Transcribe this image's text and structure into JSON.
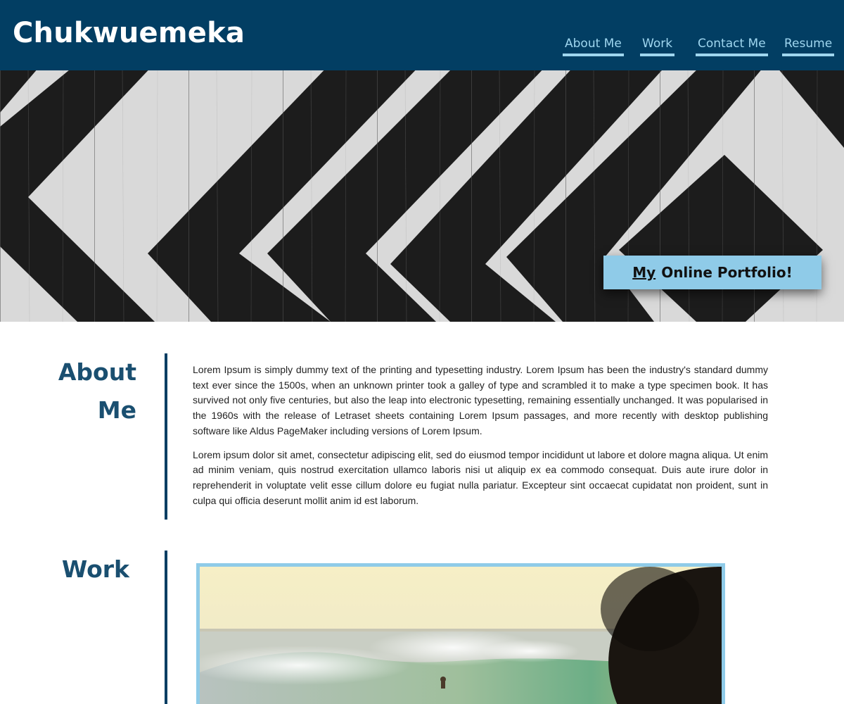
{
  "header": {
    "site_name": "Chukwuemeka",
    "nav": [
      {
        "label": "About Me"
      },
      {
        "label": "Work"
      },
      {
        "label": "Contact Me"
      },
      {
        "label": "Resume"
      }
    ]
  },
  "hero": {
    "badge_prefix": "My",
    "badge_rest": "Online Portfolio!"
  },
  "about": {
    "title_line1": "About",
    "title_line2": "Me",
    "paragraphs": [
      "Lorem Ipsum is simply dummy text of the printing and typesetting industry. Lorem Ipsum has been the industry's standard dummy text ever since the 1500s, when an unknown printer took a galley of type and scrambled it to make a type specimen book. It has survived not only five centuries, but also the leap into electronic typesetting, remaining essentially unchanged. It was popularised in the 1960s with the release of Letraset sheets containing Lorem Ipsum passages, and more recently with desktop publishing software like Aldus PageMaker including versions of Lorem Ipsum.",
      "Lorem ipsum dolor sit amet, consectetur adipiscing elit, sed do eiusmod tempor incididunt ut labore et dolore magna aliqua. Ut enim ad minim veniam, quis nostrud exercitation ullamco laboris nisi ut aliquip ex ea commodo consequat. Duis aute irure dolor in reprehenderit in voluptate velit esse cillum dolore eu fugiat nulla pariatur. Excepteur sint occaecat cupidatat non proident, sunt in culpa qui officia deserunt mollit anim id est laborum."
    ]
  },
  "work": {
    "title": "Work",
    "image": "surfer-wave-photo"
  },
  "colors": {
    "header_bg": "#023e63",
    "nav_accent": "#9fd6ef",
    "heading": "#1a4f70",
    "badge_bg": "#8fcbe8"
  }
}
